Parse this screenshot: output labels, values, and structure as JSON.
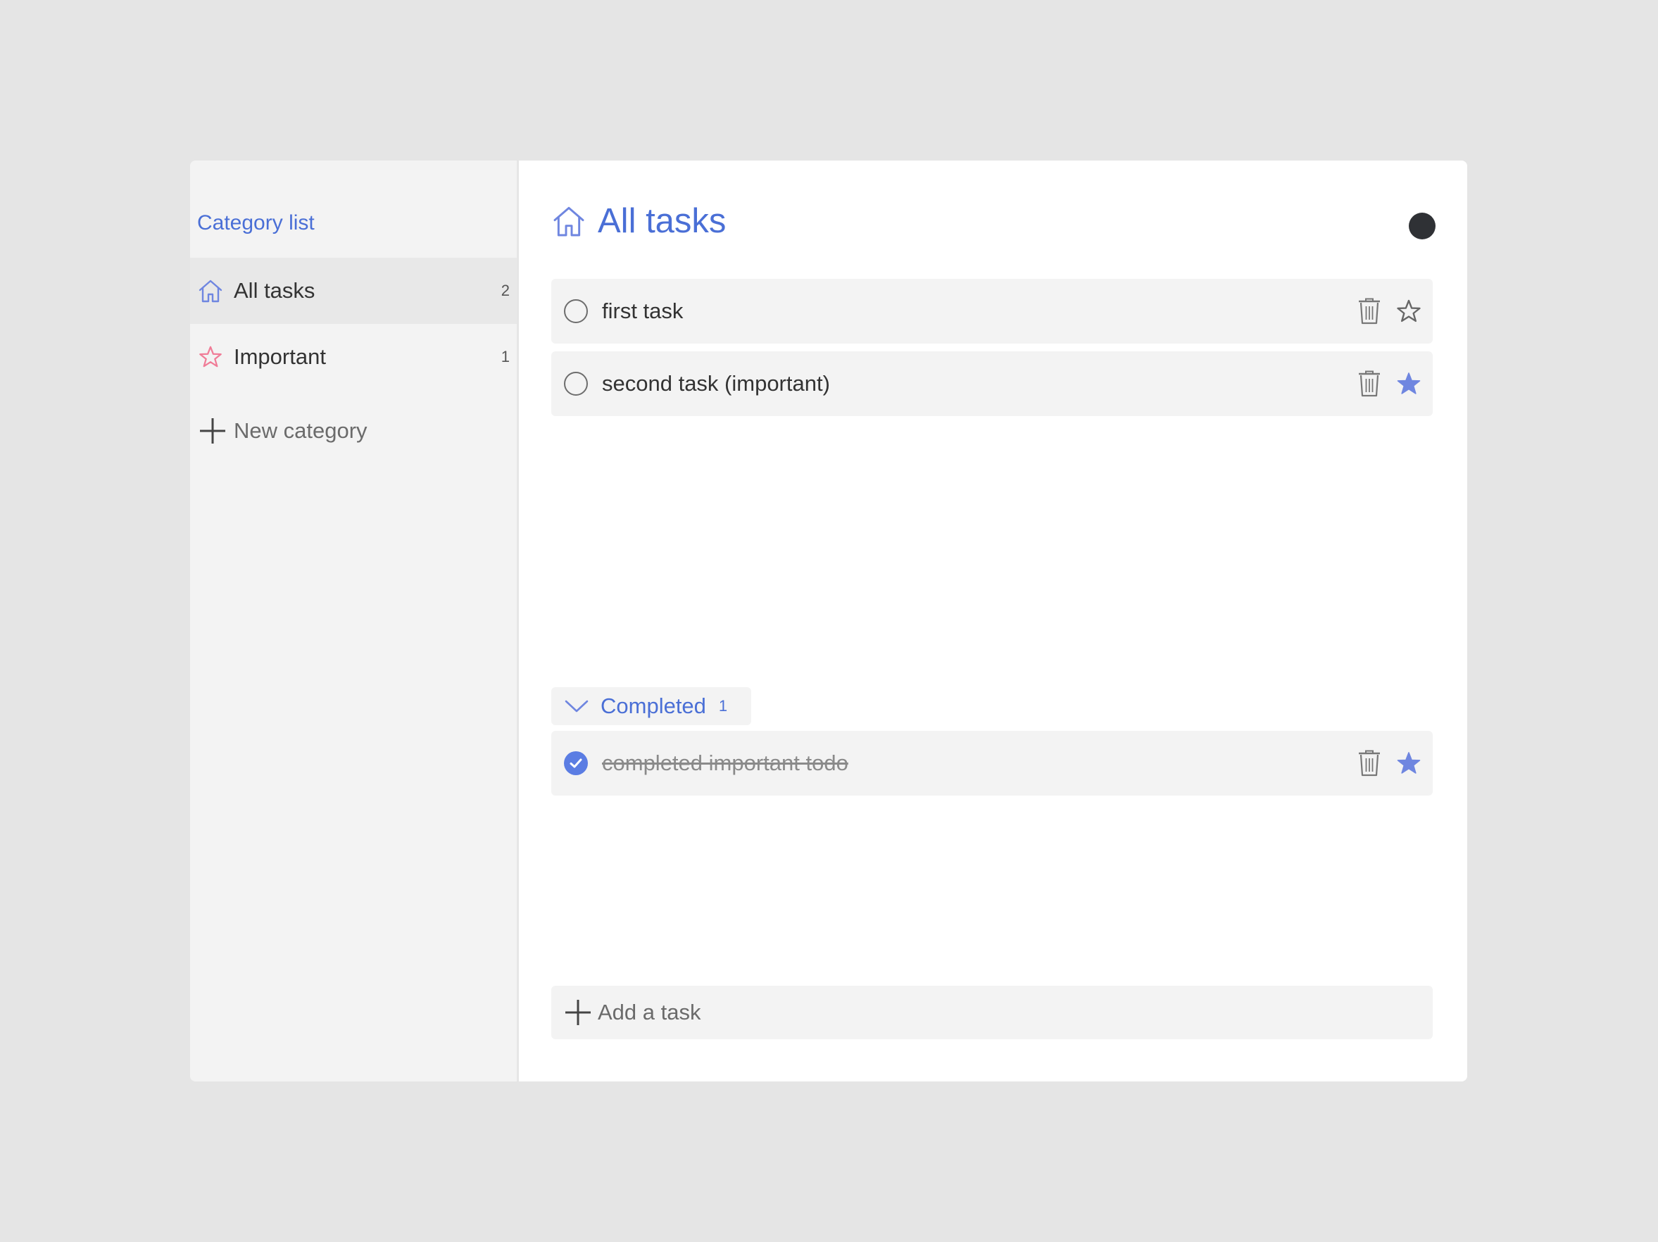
{
  "sidebar": {
    "title": "Category list",
    "categories": [
      {
        "label": "All tasks",
        "count": "2",
        "icon": "home-icon",
        "active": true
      },
      {
        "label": "Important",
        "count": "1",
        "icon": "star-outline-icon",
        "active": false
      }
    ],
    "new_category_label": "New category"
  },
  "main": {
    "title": "All tasks",
    "title_icon": "home-icon",
    "tasks": [
      {
        "label": "first task",
        "completed": false,
        "important": false
      },
      {
        "label": "second task (important)",
        "completed": false,
        "important": true
      }
    ],
    "completed_section": {
      "label": "Completed",
      "count": "1",
      "tasks": [
        {
          "label": "completed important todo",
          "completed": true,
          "important": true
        }
      ]
    },
    "add_task_placeholder": "Add a task"
  },
  "colors": {
    "accent": "#4a6fd6",
    "star_filled": "#6f86e0",
    "important_icon": "#f07c97",
    "background": "#e5e5e5",
    "panel": "#f3f3f3",
    "theme_toggle": "#2f3135"
  }
}
